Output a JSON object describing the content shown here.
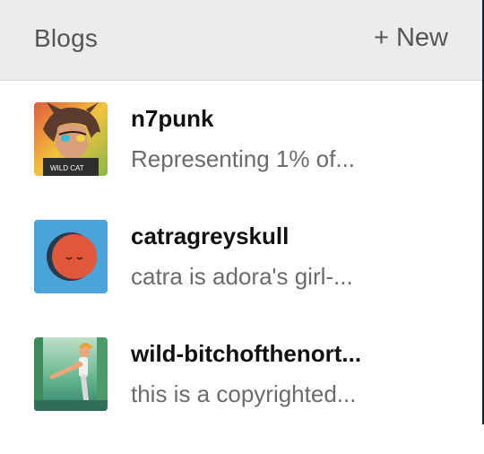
{
  "header": {
    "title": "Blogs",
    "new_label": "+ New"
  },
  "blogs": [
    {
      "name": "n7punk",
      "description": "Representing 1% of...",
      "avatar_icon": "catra-portrait-avatar",
      "avatar_text": "WILD CAT"
    },
    {
      "name": "catragreyskull",
      "description": "catra is adora's girl-...",
      "avatar_icon": "sleeping-moon-avatar",
      "avatar_color": "#4aa3d9"
    },
    {
      "name": "wild-bitchofthenort...",
      "description": "this is a copyrighted...",
      "avatar_icon": "kicking-character-avatar"
    }
  ]
}
